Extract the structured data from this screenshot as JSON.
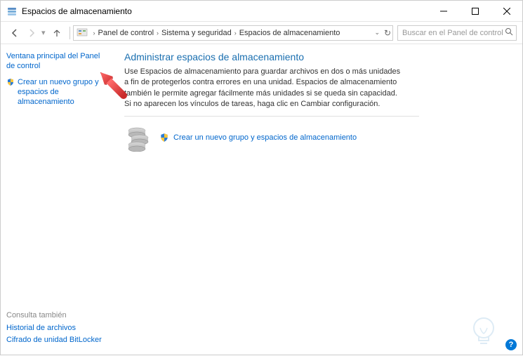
{
  "window": {
    "title": "Espacios de almacenamiento"
  },
  "breadcrumb": {
    "items": [
      "Panel de control",
      "Sistema y seguridad",
      "Espacios de almacenamiento"
    ]
  },
  "search": {
    "placeholder": "Buscar en el Panel de control"
  },
  "sidebar": {
    "link1": "Ventana principal del Panel de control",
    "link2": "Crear un nuevo grupo y espacios de almacenamiento"
  },
  "main": {
    "title": "Administrar espacios de almacenamiento",
    "description": "Use Espacios de almacenamiento para guardar archivos en dos o más unidades a fin de protegerlos contra errores en una unidad. Espacios de almacenamiento también le permite agregar fácilmente más unidades si se queda sin capacidad. Si no aparecen los vínculos de tareas, haga clic en Cambiar configuración.",
    "action_link": "Crear un nuevo grupo y espacios de almacenamiento"
  },
  "bottom": {
    "heading": "Consulta también",
    "link1": "Historial de archivos",
    "link2": "Cifrado de unidad BitLocker"
  }
}
